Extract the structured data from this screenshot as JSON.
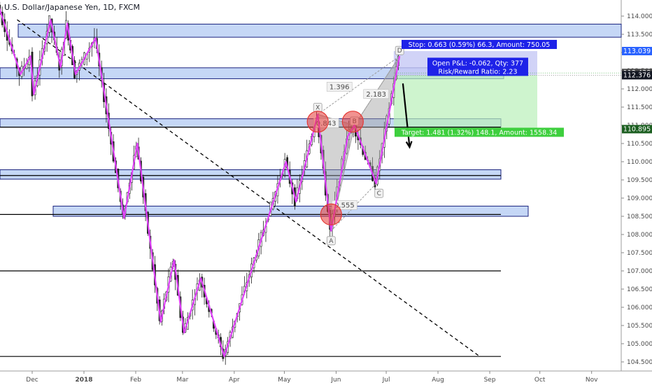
{
  "header": {
    "title": "U.S. Dollar/Japanese Yen, 1D, FXCM"
  },
  "chart_data": {
    "type": "candlestick",
    "title": "U.S. Dollar/Japanese Yen, 1D, FXCM",
    "symbol": "USDJPY",
    "timeframe": "1D",
    "source": "FXCM",
    "y_ticks": [
      "114.000",
      "113.500",
      "113.000",
      "112.500",
      "112.000",
      "111.500",
      "111.000",
      "110.500",
      "110.000",
      "109.500",
      "109.000",
      "108.500",
      "108.000",
      "107.500",
      "107.000",
      "106.500",
      "106.000",
      "105.500",
      "105.000",
      "104.500"
    ],
    "x_ticks": [
      "Dec",
      "2018",
      "Feb",
      "Mar",
      "Apr",
      "May",
      "Jun",
      "Jul",
      "Aug",
      "Sep",
      "Oct",
      "Nov"
    ],
    "price_tags": [
      {
        "value": "113.039",
        "color": "#2962ff"
      },
      {
        "value": "112.438",
        "color": "#4a4a4a"
      },
      {
        "value": "112.376",
        "color": "#131722"
      },
      {
        "value": "110.895",
        "color": "#1b5e20"
      }
    ],
    "zones": [
      {
        "top": 113.78,
        "bottom": 113.42
      },
      {
        "top": 112.58,
        "bottom": 112.28
      },
      {
        "top": 111.18,
        "bottom": 110.95
      },
      {
        "top": 109.78,
        "bottom": 109.52
      },
      {
        "top": 108.78,
        "bottom": 108.5
      }
    ],
    "horizontal_lines": [
      110.95,
      109.62,
      108.55,
      107.0,
      104.65
    ],
    "trendline": {
      "from": {
        "date": "2017-11-22",
        "price": 113.9
      },
      "to": {
        "date": "2018-08-26",
        "price": 104.65
      }
    },
    "zigzag": [
      {
        "date": "2017-11-08",
        "price": 114.7
      },
      {
        "date": "2017-11-24",
        "price": 112.4
      },
      {
        "date": "2017-11-30",
        "price": 112.9
      },
      {
        "date": "2017-12-02",
        "price": 111.85
      },
      {
        "date": "2017-12-12",
        "price": 113.9
      },
      {
        "date": "2017-12-18",
        "price": 112.6
      },
      {
        "date": "2017-12-22",
        "price": 113.8
      },
      {
        "date": "2017-12-27",
        "price": 112.4
      },
      {
        "date": "2018-01-08",
        "price": 113.4
      },
      {
        "date": "2018-01-25",
        "price": 108.45
      },
      {
        "date": "2018-02-02",
        "price": 110.5
      },
      {
        "date": "2018-02-16",
        "price": 105.6
      },
      {
        "date": "2018-02-24",
        "price": 107.3
      },
      {
        "date": "2018-03-02",
        "price": 105.3
      },
      {
        "date": "2018-03-12",
        "price": 106.8
      },
      {
        "date": "2018-03-26",
        "price": 104.65
      },
      {
        "date": "2018-05-02",
        "price": 110.0
      },
      {
        "date": "2018-05-08",
        "price": 108.9
      },
      {
        "date": "2018-05-21",
        "price": 111.3
      },
      {
        "date": "2018-05-29",
        "price": 108.1
      },
      {
        "date": "2018-06-08",
        "price": 110.7
      },
      {
        "date": "2018-06-12",
        "price": 111.0
      },
      {
        "date": "2018-06-25",
        "price": 109.4
      },
      {
        "date": "2018-07-09",
        "price": 112.9
      }
    ],
    "harmonic": {
      "X": {
        "date": "2018-05-21",
        "price": 111.3
      },
      "A": {
        "date": "2018-05-29",
        "price": 108.1
      },
      "B": {
        "date": "2018-06-12",
        "price": 111.0
      },
      "C": {
        "date": "2018-06-25",
        "price": 109.4
      },
      "D": {
        "date": "2018-07-09",
        "price": 112.9
      },
      "ratios": [
        {
          "label": "0.843",
          "date": "2018-05-26",
          "price": 111.05
        },
        {
          "label": "0.555",
          "date": "2018-06-06",
          "price": 108.8
        },
        {
          "label": "2.183",
          "date": "2018-06-25",
          "price": 111.85
        },
        {
          "label": "1.396",
          "date": "2018-06-03",
          "price": 112.05
        }
      ]
    },
    "circles": [
      {
        "date": "2018-05-21",
        "price": 111.1
      },
      {
        "date": "2018-06-11",
        "price": 111.1
      },
      {
        "date": "2018-05-29",
        "price": 108.55
      }
    ],
    "position": {
      "entry": 112.376,
      "stop": 113.039,
      "target": 110.895,
      "start": "2018-07-03",
      "end": "2018-08-26",
      "stop_label": "Stop: 0.663 (0.59%) 66.3, Amount: 750.05",
      "pnl_label": "Open P&L: -0.062, Qty: 377",
      "rr_label": "Risk/Reward Ratio: 2.23",
      "target_label": "Target: 1.481 (1.32%) 148.1, Amount: 1558.34"
    },
    "arrow": {
      "from": {
        "date": "2018-07-11",
        "price": 112.15
      },
      "to": {
        "date": "2018-07-15",
        "price": 110.4
      }
    },
    "colors": {
      "up": "#26a69a",
      "down": "#ef5350",
      "candle": "#222222",
      "zigzag": "#e040fb",
      "zone_fill": "#bbd0f5",
      "zone_border": "#1a237e",
      "stop_fill": "#c5c8f5",
      "target_fill": "#b9f0b9",
      "circle": "#e53935"
    }
  }
}
